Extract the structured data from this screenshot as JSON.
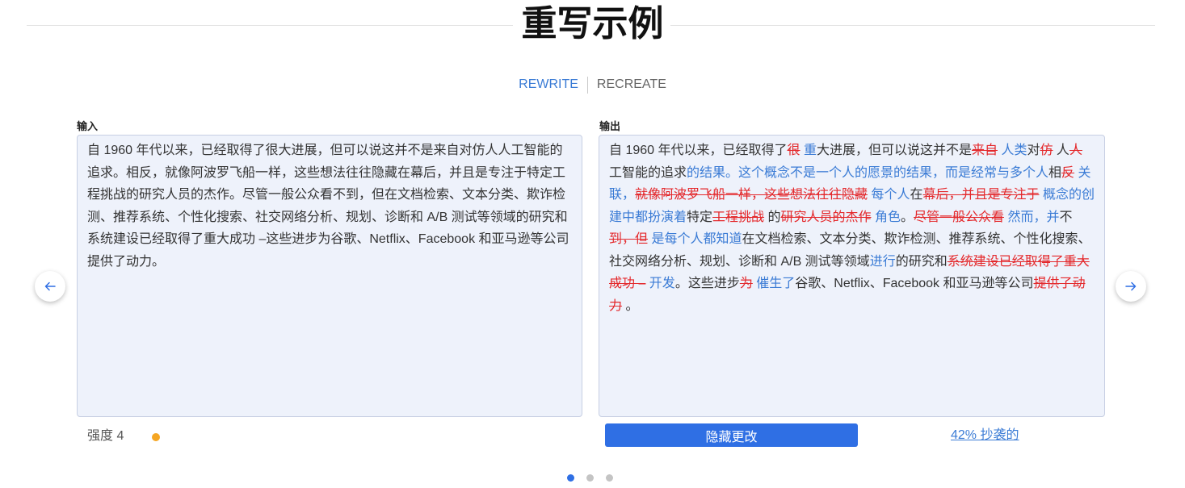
{
  "title": "重写示例",
  "tabs": [
    {
      "label": "REWRITE",
      "active": true
    },
    {
      "label": "RECREATE",
      "active": false
    }
  ],
  "input": {
    "label": "输入",
    "text": "自 1960 年代以来，已经取得了很大进展，但可以说这并不是来自对仿人人工智能的追求。相反，就像阿波罗飞船一样，这些想法往往隐藏在幕后，并且是专注于特定工程挑战的研究人员的杰作。尽管一般公众看不到，但在文档检索、文本分类、欺诈检测、推荐系统、个性化搜索、社交网络分析、规划、诊断和 A/B 测试等领域的研究和系统建设已经取得了重大成功 –这些进步为谷歌、Netflix、Facebook 和亚马逊等公司提供了动力。"
  },
  "output": {
    "label": "输出",
    "segments": [
      {
        "type": "keep",
        "text": "自 1960 年代以来，已经取得了"
      },
      {
        "type": "del",
        "text": "很"
      },
      {
        "type": "ins",
        "text": " 重"
      },
      {
        "type": "keep",
        "text": "大进展，但可以说这并不是"
      },
      {
        "type": "del",
        "text": "来自"
      },
      {
        "type": "ins",
        "text": " 人类"
      },
      {
        "type": "keep",
        "text": "对"
      },
      {
        "type": "del",
        "text": "仿"
      },
      {
        "type": "keep",
        "text": " 人"
      },
      {
        "type": "del",
        "text": "人"
      },
      {
        "type": "keep",
        "text": "工智能的追求"
      },
      {
        "type": "ins",
        "text": "的结果。这个概念不是一个人的愿景的结果，而是经常与多个人"
      },
      {
        "type": "keep",
        "text": "相"
      },
      {
        "type": "del",
        "text": "反"
      },
      {
        "type": "ins",
        "text": " 关联，"
      },
      {
        "type": "del",
        "text": "就像阿波罗飞船一样，这些想法往往隐藏"
      },
      {
        "type": "ins",
        "text": " 每个人"
      },
      {
        "type": "keep",
        "text": "在"
      },
      {
        "type": "del",
        "text": "幕后，并且是专注于"
      },
      {
        "type": "ins",
        "text": " 概念的创建中都扮演着"
      },
      {
        "type": "keep",
        "text": "特定"
      },
      {
        "type": "del",
        "text": "工程挑战"
      },
      {
        "type": "keep",
        "text": " 的"
      },
      {
        "type": "del",
        "text": "研究人员的杰作"
      },
      {
        "type": "ins",
        "text": " 角色"
      },
      {
        "type": "keep",
        "text": "。"
      },
      {
        "type": "del",
        "text": "尽管一般公众看"
      },
      {
        "type": "ins",
        "text": " 然而，并"
      },
      {
        "type": "keep",
        "text": "不"
      },
      {
        "type": "del",
        "text": "到，但"
      },
      {
        "type": "ins",
        "text": " 是每个人都知道"
      },
      {
        "type": "keep",
        "text": "在文档检索、文本分类、欺诈检测、推荐系统、个性化搜索、社交网络分析、规划、诊断和 A/B 测试等领域"
      },
      {
        "type": "ins",
        "text": "进行"
      },
      {
        "type": "keep",
        "text": "的研究和"
      },
      {
        "type": "del",
        "text": "系统建设已经取得了重大成功 –"
      },
      {
        "type": "ins",
        "text": " 开发"
      },
      {
        "type": "keep",
        "text": "。这些进步"
      },
      {
        "type": "del",
        "text": "为"
      },
      {
        "type": "ins",
        "text": " 催生了"
      },
      {
        "type": "keep",
        "text": "谷歌、Netflix、Facebook 和亚马逊等公司"
      },
      {
        "type": "del",
        "text": "提供了动力"
      },
      {
        "type": "keep",
        "text": " 。"
      }
    ]
  },
  "strength": {
    "label": "强度",
    "value": "4"
  },
  "hide_changes_button": "隐藏更改",
  "plagiarism_link": "42% 抄袭的",
  "navigation": {
    "prev_icon": "arrow-left-icon",
    "next_icon": "arrow-right-icon"
  },
  "pagination": {
    "pages": 3,
    "current": 1
  },
  "colors": {
    "accent": "#2f6fe4",
    "deleted": "#e4282b",
    "inserted": "#3a7bd5",
    "text": "#333333",
    "strength_dot": "#f5a623"
  }
}
